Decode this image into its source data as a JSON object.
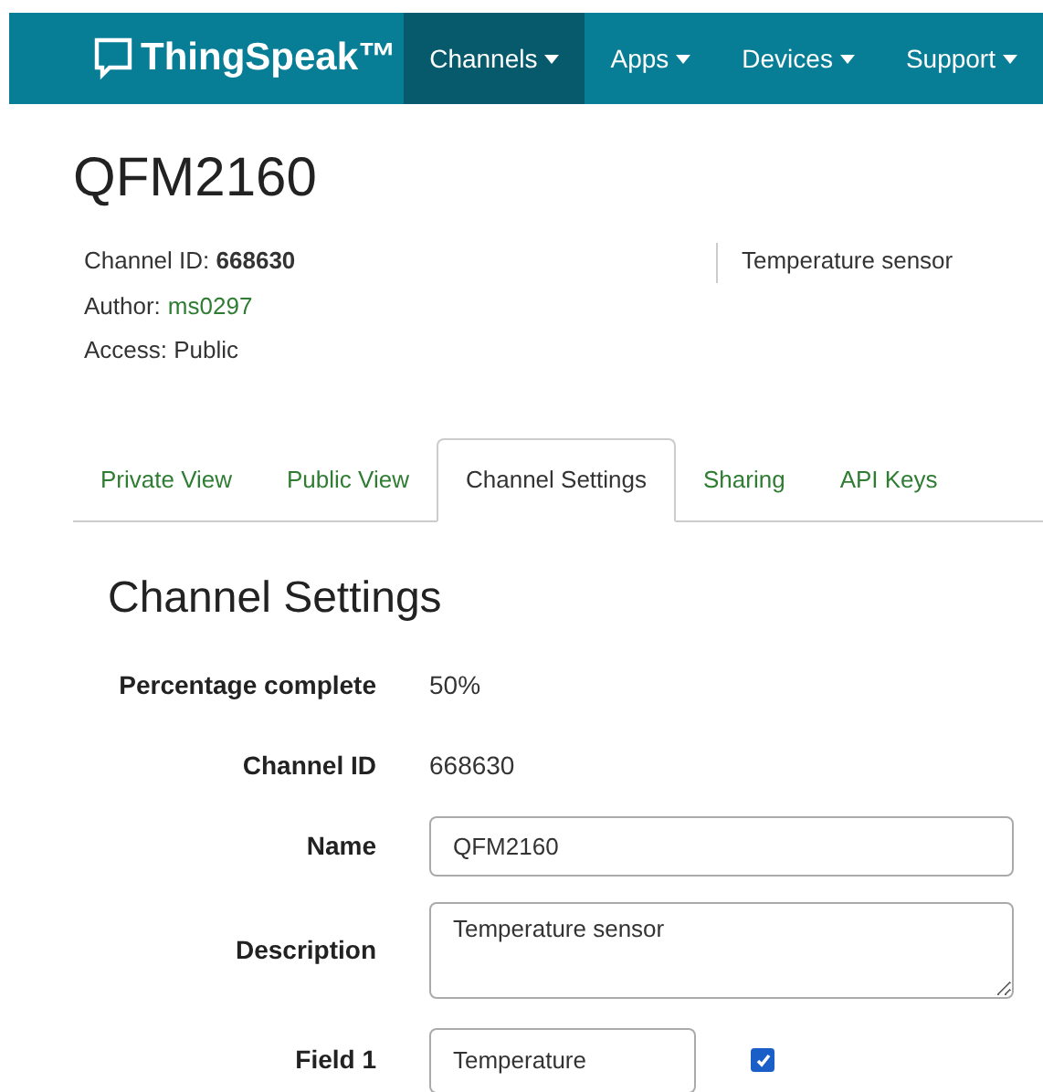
{
  "navbar": {
    "brand": "ThingSpeak™",
    "items": [
      {
        "label": "Channels",
        "selected": true
      },
      {
        "label": "Apps",
        "selected": false
      },
      {
        "label": "Devices",
        "selected": false
      },
      {
        "label": "Support",
        "selected": false
      }
    ]
  },
  "channel": {
    "title": "QFM2160",
    "id_label": "Channel ID:",
    "id_value": "668630",
    "author_label": "Author:",
    "author_value": "ms0297",
    "access": "Access: Public",
    "description": "Temperature sensor"
  },
  "tabs": [
    {
      "label": "Private View",
      "selected": false
    },
    {
      "label": "Public View",
      "selected": false
    },
    {
      "label": "Channel Settings",
      "selected": true
    },
    {
      "label": "Sharing",
      "selected": false
    },
    {
      "label": "API Keys",
      "selected": false
    }
  ],
  "settings": {
    "heading": "Channel Settings",
    "rows": [
      {
        "kind": "text",
        "label": "Percentage complete",
        "value": "50%"
      },
      {
        "kind": "text",
        "label": "Channel ID",
        "value": "668630"
      },
      {
        "kind": "input",
        "label": "Name",
        "value": "QFM2160"
      },
      {
        "kind": "textarea",
        "label": "Description",
        "value": "Temperature sensor"
      },
      {
        "kind": "field",
        "label": "Field 1",
        "value": "Temperature",
        "checked": true
      }
    ]
  }
}
